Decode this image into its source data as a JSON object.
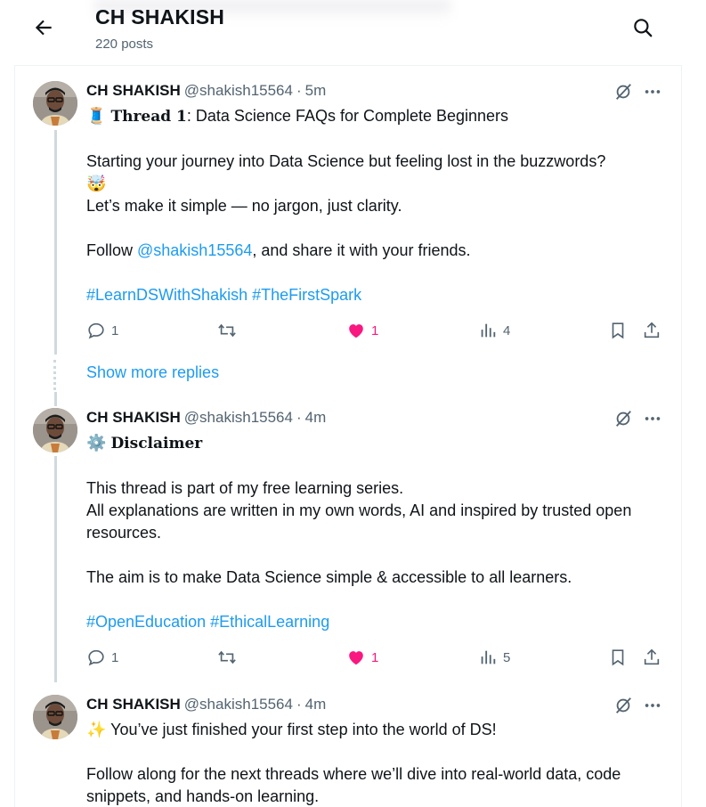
{
  "header": {
    "title": "CH SHAKISH",
    "post_count": "220 posts"
  },
  "icons": {
    "back": "arrow-left-icon",
    "search": "search-icon",
    "grok": "grok-slash-icon",
    "more": "more-horizontal-icon",
    "reply": "reply-icon",
    "retweet": "retweet-icon",
    "like": "heart-icon",
    "views": "views-bar-chart-icon",
    "bookmark": "bookmark-icon",
    "share": "share-icon"
  },
  "colors": {
    "link": "#1d9bf0",
    "like": "#f91880",
    "muted": "#536471",
    "thread_line": "#cfd9de"
  },
  "tweets": [
    {
      "name": "CH SHAKISH",
      "handle": "@shakish15564",
      "sep": "·",
      "time": "5m",
      "line1_emoji": "🧵",
      "line1_bold": "Thread 1",
      "line1_rest": ": Data Science FAQs for Complete Beginners",
      "p2": "Starting your journey into Data Science but feeling lost in the buzzwords?",
      "p2_emoji": "🤯",
      "p3": "Let’s make it simple — no jargon, just clarity.",
      "p4_pre": "Follow ",
      "p4_mention": "@shakish15564",
      "p4_post": ", and share it with your friends.",
      "hashtags": "#LearnDSWithShakish #TheFirstSpark",
      "replies": "1",
      "likes": "1",
      "views": "4"
    },
    {
      "name": "CH SHAKISH",
      "handle": "@shakish15564",
      "sep": "·",
      "time": "4m",
      "line1_emoji": "⚙️",
      "line1_bold": "Disclaimer",
      "p2": "This thread is part of my free learning series.",
      "p3": "All explanations are written in my own words, AI and inspired by trusted open resources.",
      "p4": "The aim is to make Data Science simple & accessible to all learners.",
      "hashtags": "#OpenEducation #EthicalLearning",
      "replies": "1",
      "likes": "1",
      "views": "5"
    },
    {
      "name": "CH SHAKISH",
      "handle": "@shakish15564",
      "sep": "·",
      "time": "4m",
      "line1_emoji": "✨",
      "line1_rest": " You’ve just finished your first step into the world of DS!",
      "p2": "Follow along for the next threads where we’ll dive into real-world data, code snippets, and hands-on learning."
    }
  ],
  "show_more": "Show more replies"
}
